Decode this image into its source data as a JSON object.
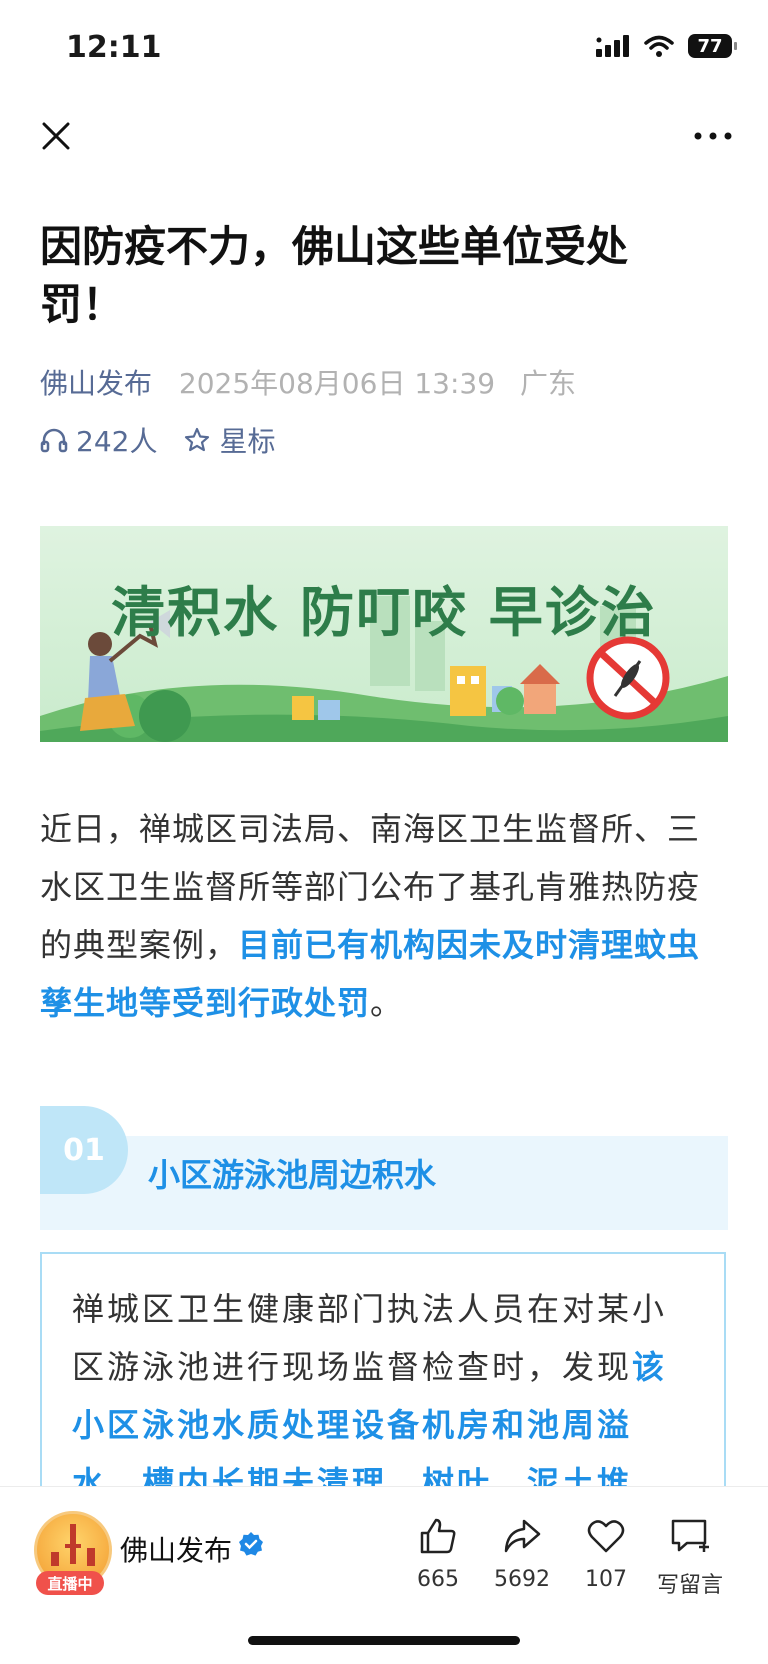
{
  "status_bar": {
    "time": "12:11",
    "battery": "77"
  },
  "article": {
    "title": "因防疫不力，佛山这些单位受处罚！",
    "author": "佛山发布",
    "date": "2025年08月06日 13:39",
    "location": "广东",
    "listeners": "242人",
    "star_label": "星标"
  },
  "banner": {
    "text": "清积水 防叮咬 早诊治"
  },
  "paragraph": {
    "normal": "近日，禅城区司法局、南海区卫生监督所、三水区卫生监督所等部门公布了基孔肯雅热防疫的典型案例，",
    "highlight": "目前已有机构因未及时清理蚊虫孳生地等受到行政处罚",
    "end": "。"
  },
  "section1": {
    "number": "01",
    "title": "小区游泳池周边积水",
    "text_normal": "禅城区卫生健康部门执法人员在对某小区游泳池进行现场监督检查时，发现",
    "text_highlight": "该小区泳池水质处理设备机房和池周溢水、槽内长期未清理，树叶、泥土堆"
  },
  "bottom_bar": {
    "account_name": "佛山发布",
    "live_badge": "直播中",
    "like_count": "665",
    "share_count": "5692",
    "favorite_count": "107",
    "comment_label": "写留言"
  },
  "colors": {
    "accent": "#1e90e6",
    "link": "#576b95",
    "banner_text": "#2e7d4a",
    "live": "#f0514b"
  },
  "icons": [
    "close-icon",
    "more-icon",
    "headphones-icon",
    "star-icon",
    "verified-icon",
    "thumbs-up-icon",
    "share-icon",
    "heart-icon",
    "comment-icon",
    "signal-icon",
    "wifi-icon"
  ]
}
